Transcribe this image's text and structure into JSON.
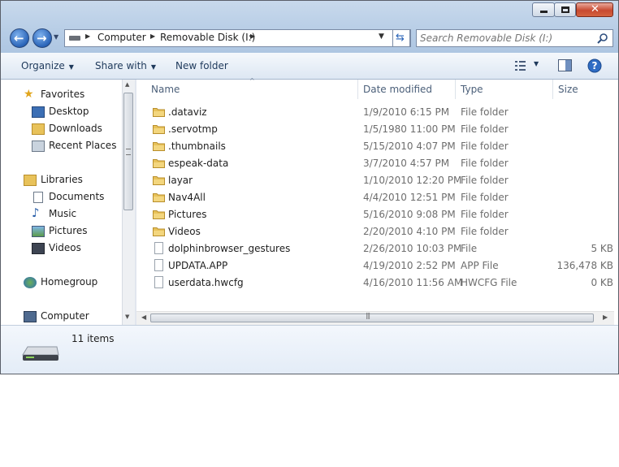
{
  "window": {
    "controls": [
      "minimize-icon",
      "maximize-icon",
      "close-icon"
    ]
  },
  "address": {
    "crumbs": [
      "Computer",
      "Removable Disk (I:)"
    ]
  },
  "search": {
    "placeholder": "Search Removable Disk (I:)"
  },
  "toolbar": {
    "organize": "Organize",
    "share_with": "Share with",
    "new_folder": "New folder"
  },
  "nav": {
    "favorites": "Favorites",
    "desktop": "Desktop",
    "downloads": "Downloads",
    "recent_places": "Recent Places",
    "libraries": "Libraries",
    "documents": "Documents",
    "music": "Music",
    "pictures": "Pictures",
    "videos": "Videos",
    "homegroup": "Homegroup",
    "computer": "Computer"
  },
  "columns": {
    "name": "Name",
    "date": "Date modified",
    "type": "Type",
    "size": "Size"
  },
  "files": [
    {
      "name": ".dataviz",
      "date": "1/9/2010 6:15 PM",
      "type": "File folder",
      "size": "",
      "icon": "folder-icon"
    },
    {
      "name": ".servotmp",
      "date": "1/5/1980 11:00 PM",
      "type": "File folder",
      "size": "",
      "icon": "folder-icon"
    },
    {
      "name": ".thumbnails",
      "date": "5/15/2010 4:07 PM",
      "type": "File folder",
      "size": "",
      "icon": "folder-icon"
    },
    {
      "name": "espeak-data",
      "date": "3/7/2010 4:57 PM",
      "type": "File folder",
      "size": "",
      "icon": "folder-icon"
    },
    {
      "name": "layar",
      "date": "1/10/2010 12:20 PM",
      "type": "File folder",
      "size": "",
      "icon": "folder-icon"
    },
    {
      "name": "Nav4All",
      "date": "4/4/2010 12:51 PM",
      "type": "File folder",
      "size": "",
      "icon": "folder-icon"
    },
    {
      "name": "Pictures",
      "date": "5/16/2010 9:08 PM",
      "type": "File folder",
      "size": "",
      "icon": "folder-icon"
    },
    {
      "name": "Videos",
      "date": "2/20/2010 4:10 PM",
      "type": "File folder",
      "size": "",
      "icon": "folder-icon"
    },
    {
      "name": "dolphinbrowser_gestures",
      "date": "2/26/2010 10:03 PM",
      "type": "File",
      "size": "5 KB",
      "icon": "file-icon"
    },
    {
      "name": "UPDATA.APP",
      "date": "4/19/2010 2:52 PM",
      "type": "APP File",
      "size": "136,478 KB",
      "icon": "file-icon"
    },
    {
      "name": "userdata.hwcfg",
      "date": "4/16/2010 11:56 AM",
      "type": "HWCFG File",
      "size": "0 KB",
      "icon": "file-icon"
    }
  ],
  "details": {
    "count": "11 items"
  },
  "colors": {
    "accent": "#1e395b",
    "titlebar": "#b7cde6",
    "folder": "#e8c25a"
  }
}
